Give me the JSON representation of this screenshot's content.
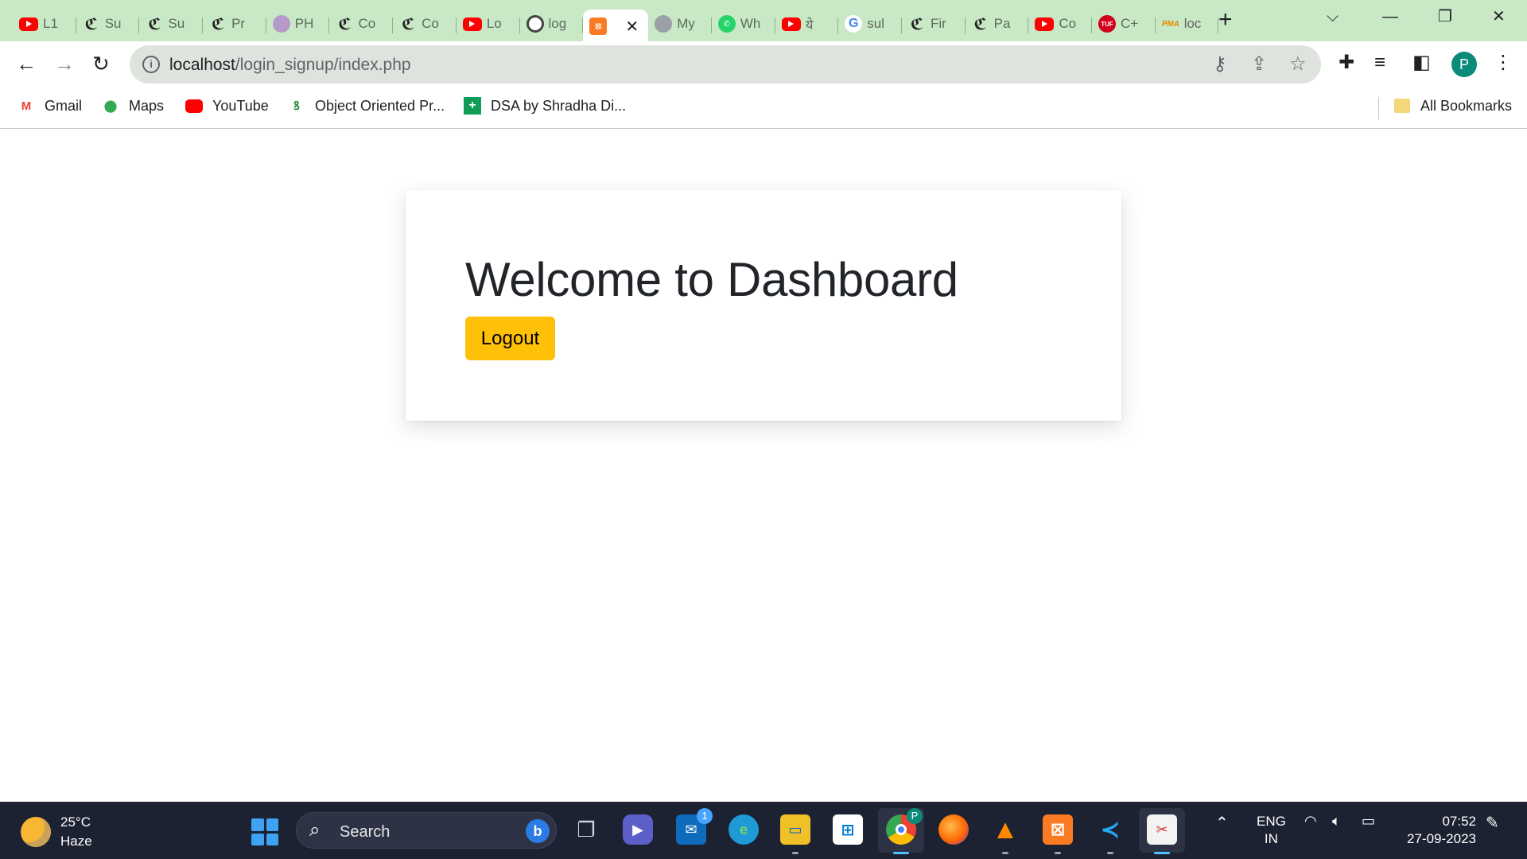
{
  "tabs": [
    {
      "icon": "youtube-icon",
      "title": "L1"
    },
    {
      "icon": "leetcode-icon",
      "title": "Su"
    },
    {
      "icon": "leetcode-icon",
      "title": "Su"
    },
    {
      "icon": "leetcode-icon",
      "title": "Pr"
    },
    {
      "icon": "avatar-icon",
      "title": "PH"
    },
    {
      "icon": "leetcode-icon",
      "title": "Co"
    },
    {
      "icon": "leetcode-icon",
      "title": "Co"
    },
    {
      "icon": "youtube-icon",
      "title": "Lo"
    },
    {
      "icon": "github-icon",
      "title": "log"
    },
    {
      "icon": "xampp-icon",
      "title": "",
      "active": true
    },
    {
      "icon": "globe-icon",
      "title": "My"
    },
    {
      "icon": "whatsapp-icon",
      "title": "Wh"
    },
    {
      "icon": "youtube-icon",
      "title": "ये"
    },
    {
      "icon": "google-icon",
      "title": "sul"
    },
    {
      "icon": "leetcode-icon",
      "title": "Fir"
    },
    {
      "icon": "leetcode-icon",
      "title": "Pa"
    },
    {
      "icon": "youtube-icon",
      "title": "Co"
    },
    {
      "icon": "tuf-icon",
      "title": "C+"
    },
    {
      "icon": "phpmyadmin-icon",
      "title": "loc"
    }
  ],
  "tab_fav_text": {
    "tuf": "TUF",
    "pma": "PMA",
    "lc": "ℭ",
    "g": "G",
    "wa": "✆",
    "xa": "⊠",
    "gh": "",
    "globe": ""
  },
  "address_bar": {
    "host": "localhost",
    "path": "/login_signup/index.php"
  },
  "profile_initial": "P",
  "bookmarks": [
    {
      "icon": "gmail-icon",
      "label": "Gmail"
    },
    {
      "icon": "maps-icon",
      "label": "Maps"
    },
    {
      "icon": "youtube-icon",
      "label": "YouTube"
    },
    {
      "icon": "geeksforgeeks-icon",
      "label": "Object Oriented Pr..."
    },
    {
      "icon": "sheets-icon",
      "label": "DSA by Shradha Di..."
    }
  ],
  "all_bookmarks_label": "All Bookmarks",
  "page": {
    "heading": "Welcome to Dashboard",
    "logout_label": "Logout"
  },
  "colors": {
    "logout_button": "#ffc107",
    "tabstrip": "#c9e8c6",
    "taskbar": "#1c2231"
  },
  "taskbar": {
    "weather": {
      "temp": "25°C",
      "condition": "Haze"
    },
    "search_label": "Search",
    "mail_badge": "1",
    "chrome_badge": "P",
    "language": {
      "line1": "ENG",
      "line2": "IN"
    },
    "clock": {
      "time": "07:52",
      "date": "27-09-2023"
    }
  }
}
